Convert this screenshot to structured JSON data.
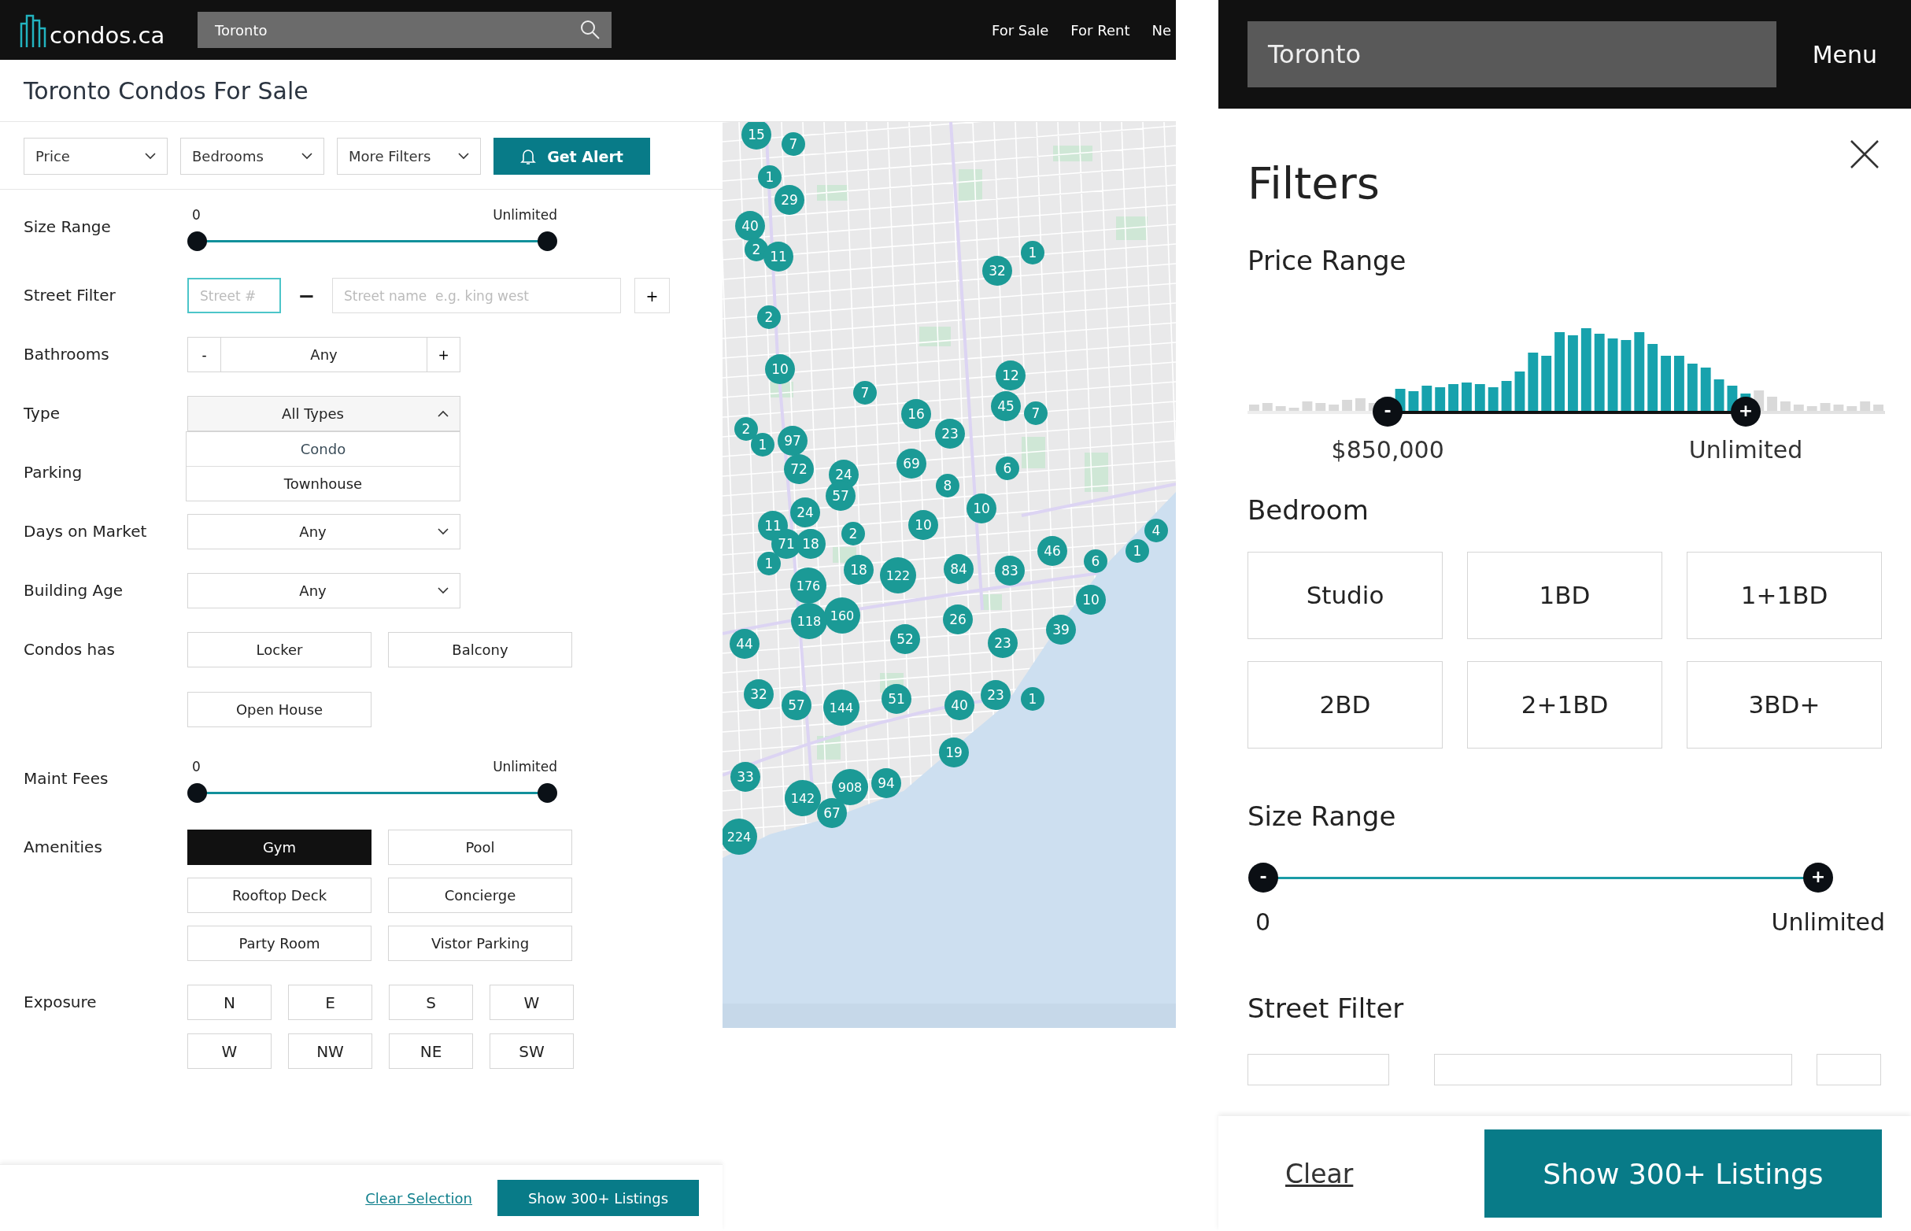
{
  "desktop": {
    "header": {
      "logo": "condos.ca",
      "search": {
        "value": "Toronto"
      },
      "nav": [
        "For Sale",
        "For Rent",
        "Ne"
      ]
    },
    "page_title": "Toronto Condos For Sale",
    "filter_bar": {
      "dropdowns": [
        "Price",
        "Bedrooms",
        "More Filters"
      ],
      "alert_button": "Get Alert"
    },
    "filters": [
      {
        "kind": "range",
        "label": "Size Range",
        "min": "0",
        "max": "Unlimited",
        "level": 1
      },
      {
        "kind": "street",
        "label": "Street Filter",
        "number_placeholder": "Street #",
        "number_focused": true,
        "separator": "−",
        "name_placeholder": "Street name  e.g. king west",
        "add": "+"
      },
      {
        "kind": "stepper",
        "label": "Bathrooms",
        "minus": "-",
        "value": "Any",
        "plus": "+"
      },
      {
        "kind": "select",
        "label": "Type",
        "value": "All Types",
        "expanded": true,
        "options": [
          {
            "label": "Condo",
            "selected": true
          },
          {
            "label": "Townhouse",
            "selected": false
          }
        ]
      },
      {
        "kind": "covered",
        "label": "Parking"
      },
      {
        "kind": "select",
        "label": "Days on Market",
        "value": "Any",
        "expanded": false
      },
      {
        "kind": "select",
        "label": "Building Age",
        "value": "Any",
        "expanded": false
      },
      {
        "kind": "toggles",
        "label": "Condos has",
        "options": [
          {
            "label": "Locker",
            "selected": false
          },
          {
            "label": "Balcony",
            "selected": false
          },
          {
            "label": "Open House",
            "selected": false
          }
        ]
      },
      {
        "kind": "range",
        "label": "Maint Fees",
        "min": "0",
        "max": "Unlimited",
        "level": 1
      },
      {
        "kind": "toggles",
        "label": "Amenities",
        "options": [
          {
            "label": "Gym",
            "selected": true
          },
          {
            "label": "Pool",
            "selected": false
          },
          {
            "label": "Rooftop Deck",
            "selected": false
          },
          {
            "label": "Concierge",
            "selected": false
          },
          {
            "label": "Party Room",
            "selected": false
          },
          {
            "label": "Vistor Parking",
            "selected": false
          }
        ]
      },
      {
        "kind": "compass",
        "label": "Exposure",
        "options": [
          {
            "label": "N",
            "selected": false
          },
          {
            "label": "E",
            "selected": false
          },
          {
            "label": "S",
            "selected": false
          },
          {
            "label": "W",
            "selected": false
          },
          {
            "label": "W",
            "selected": false
          },
          {
            "label": "NW",
            "selected": false
          },
          {
            "label": "NE",
            "selected": false
          },
          {
            "label": "SW",
            "selected": false
          }
        ]
      }
    ],
    "map": {
      "kind": "picture",
      "markers": [
        "15",
        "7",
        "1",
        "29",
        "40",
        "2",
        "11",
        "2",
        "10",
        "7",
        "1",
        "32",
        "12",
        "45",
        "7",
        "16",
        "23",
        "2",
        "1",
        "97",
        "72",
        "24",
        "57",
        "69",
        "6",
        "8",
        "10",
        "24",
        "11",
        "71",
        "18",
        "2",
        "10",
        "1",
        "18",
        "122",
        "84",
        "83",
        "46",
        "6",
        "1",
        "4",
        "176",
        "10",
        "160",
        "118",
        "26",
        "39",
        "44",
        "52",
        "23",
        "32",
        "57",
        "144",
        "51",
        "40",
        "23",
        "1",
        "19",
        "33",
        "908",
        "94",
        "142",
        "67",
        "224"
      ]
    },
    "footer": {
      "clear_link": "Clear Selection",
      "show_button": "Show 300+ Listings"
    }
  },
  "mobile": {
    "header": {
      "search": {
        "value": "Toronto"
      },
      "menu": "Menu"
    },
    "title": "Filters",
    "sections": [
      {
        "kind": "price",
        "heading": "Price Range",
        "low_thumb": "-",
        "high_thumb": "+",
        "min": "$850,000",
        "max": "Unlimited",
        "level": 0.72
      },
      {
        "kind": "options",
        "heading": "Bedroom",
        "options": [
          {
            "label": "Studio",
            "selected": false
          },
          {
            "label": "1BD",
            "selected": false
          },
          {
            "label": "1+1BD",
            "selected": false
          },
          {
            "label": "2BD",
            "selected": false
          },
          {
            "label": "2+1BD",
            "selected": false
          },
          {
            "label": "3BD+",
            "selected": false
          }
        ]
      },
      {
        "kind": "range",
        "heading": "Size Range",
        "low_thumb": "-",
        "high_thumb": "+",
        "min": "0",
        "max": "Unlimited",
        "level": 1
      },
      {
        "kind": "street",
        "heading": "Street Filter"
      }
    ],
    "footer": {
      "clear_link": "Clear",
      "show_button": "Show 300+ Listings"
    }
  }
}
